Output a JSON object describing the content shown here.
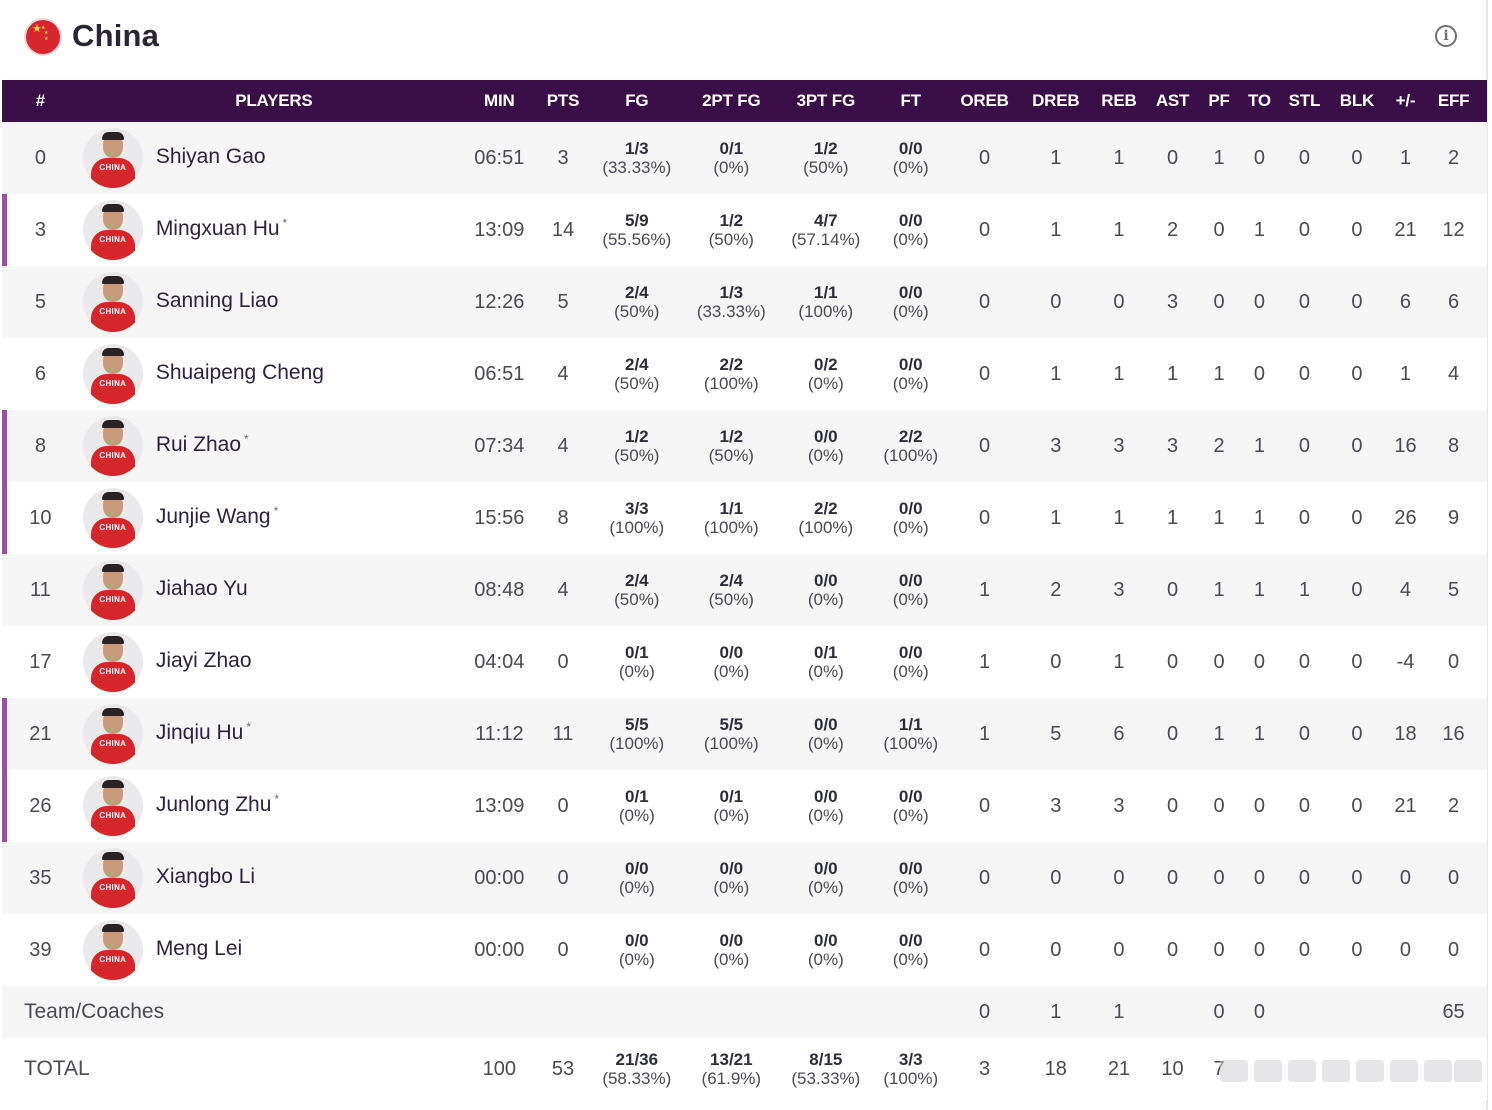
{
  "header": {
    "team_name": "China",
    "flag_icon": "china-flag-icon",
    "info_icon": "info-circle-icon"
  },
  "columns": [
    "#",
    "PLAYERS",
    "MIN",
    "PTS",
    "FG",
    "2PT FG",
    "3PT FG",
    "FT",
    "OREB",
    "DREB",
    "REB",
    "AST",
    "PF",
    "TO",
    "STL",
    "BLK",
    "+/-",
    "EFF"
  ],
  "players": [
    {
      "num": "0",
      "name": "Shiyan Gao",
      "star": "",
      "min": "06:51",
      "pts": "3",
      "fg": "1/3",
      "fg_pct": "(33.33%)",
      "fg2": "0/1",
      "fg2_pct": "(0%)",
      "fg3": "1/2",
      "fg3_pct": "(50%)",
      "ft": "0/0",
      "ft_pct": "(0%)",
      "oreb": "0",
      "dreb": "1",
      "reb": "1",
      "ast": "0",
      "pf": "1",
      "to": "0",
      "stl": "0",
      "blk": "0",
      "pm": "1",
      "eff": "2"
    },
    {
      "num": "3",
      "name": "Mingxuan Hu",
      "star": "*",
      "min": "13:09",
      "pts": "14",
      "fg": "5/9",
      "fg_pct": "(55.56%)",
      "fg2": "1/2",
      "fg2_pct": "(50%)",
      "fg3": "4/7",
      "fg3_pct": "(57.14%)",
      "ft": "0/0",
      "ft_pct": "(0%)",
      "oreb": "0",
      "dreb": "1",
      "reb": "1",
      "ast": "2",
      "pf": "0",
      "to": "1",
      "stl": "0",
      "blk": "0",
      "pm": "21",
      "eff": "12"
    },
    {
      "num": "5",
      "name": "Sanning Liao",
      "star": "",
      "min": "12:26",
      "pts": "5",
      "fg": "2/4",
      "fg_pct": "(50%)",
      "fg2": "1/3",
      "fg2_pct": "(33.33%)",
      "fg3": "1/1",
      "fg3_pct": "(100%)",
      "ft": "0/0",
      "ft_pct": "(0%)",
      "oreb": "0",
      "dreb": "0",
      "reb": "0",
      "ast": "3",
      "pf": "0",
      "to": "0",
      "stl": "0",
      "blk": "0",
      "pm": "6",
      "eff": "6"
    },
    {
      "num": "6",
      "name": "Shuaipeng Cheng",
      "star": "",
      "min": "06:51",
      "pts": "4",
      "fg": "2/4",
      "fg_pct": "(50%)",
      "fg2": "2/2",
      "fg2_pct": "(100%)",
      "fg3": "0/2",
      "fg3_pct": "(0%)",
      "ft": "0/0",
      "ft_pct": "(0%)",
      "oreb": "0",
      "dreb": "1",
      "reb": "1",
      "ast": "1",
      "pf": "1",
      "to": "0",
      "stl": "0",
      "blk": "0",
      "pm": "1",
      "eff": "4"
    },
    {
      "num": "8",
      "name": "Rui Zhao",
      "star": "*",
      "min": "07:34",
      "pts": "4",
      "fg": "1/2",
      "fg_pct": "(50%)",
      "fg2": "1/2",
      "fg2_pct": "(50%)",
      "fg3": "0/0",
      "fg3_pct": "(0%)",
      "ft": "2/2",
      "ft_pct": "(100%)",
      "oreb": "0",
      "dreb": "3",
      "reb": "3",
      "ast": "3",
      "pf": "2",
      "to": "1",
      "stl": "0",
      "blk": "0",
      "pm": "16",
      "eff": "8"
    },
    {
      "num": "10",
      "name": "Junjie Wang",
      "star": "*",
      "min": "15:56",
      "pts": "8",
      "fg": "3/3",
      "fg_pct": "(100%)",
      "fg2": "1/1",
      "fg2_pct": "(100%)",
      "fg3": "2/2",
      "fg3_pct": "(100%)",
      "ft": "0/0",
      "ft_pct": "(0%)",
      "oreb": "0",
      "dreb": "1",
      "reb": "1",
      "ast": "1",
      "pf": "1",
      "to": "1",
      "stl": "0",
      "blk": "0",
      "pm": "26",
      "eff": "9"
    },
    {
      "num": "11",
      "name": "Jiahao Yu",
      "star": "",
      "min": "08:48",
      "pts": "4",
      "fg": "2/4",
      "fg_pct": "(50%)",
      "fg2": "2/4",
      "fg2_pct": "(50%)",
      "fg3": "0/0",
      "fg3_pct": "(0%)",
      "ft": "0/0",
      "ft_pct": "(0%)",
      "oreb": "1",
      "dreb": "2",
      "reb": "3",
      "ast": "0",
      "pf": "1",
      "to": "1",
      "stl": "1",
      "blk": "0",
      "pm": "4",
      "eff": "5"
    },
    {
      "num": "17",
      "name": "Jiayi Zhao",
      "star": "",
      "min": "04:04",
      "pts": "0",
      "fg": "0/1",
      "fg_pct": "(0%)",
      "fg2": "0/0",
      "fg2_pct": "(0%)",
      "fg3": "0/1",
      "fg3_pct": "(0%)",
      "ft": "0/0",
      "ft_pct": "(0%)",
      "oreb": "1",
      "dreb": "0",
      "reb": "1",
      "ast": "0",
      "pf": "0",
      "to": "0",
      "stl": "0",
      "blk": "0",
      "pm": "-4",
      "eff": "0"
    },
    {
      "num": "21",
      "name": "Jinqiu Hu",
      "star": "*",
      "min": "11:12",
      "pts": "11",
      "fg": "5/5",
      "fg_pct": "(100%)",
      "fg2": "5/5",
      "fg2_pct": "(100%)",
      "fg3": "0/0",
      "fg3_pct": "(0%)",
      "ft": "1/1",
      "ft_pct": "(100%)",
      "oreb": "1",
      "dreb": "5",
      "reb": "6",
      "ast": "0",
      "pf": "1",
      "to": "1",
      "stl": "0",
      "blk": "0",
      "pm": "18",
      "eff": "16"
    },
    {
      "num": "26",
      "name": "Junlong Zhu",
      "star": "*",
      "min": "13:09",
      "pts": "0",
      "fg": "0/1",
      "fg_pct": "(0%)",
      "fg2": "0/1",
      "fg2_pct": "(0%)",
      "fg3": "0/0",
      "fg3_pct": "(0%)",
      "ft": "0/0",
      "ft_pct": "(0%)",
      "oreb": "0",
      "dreb": "3",
      "reb": "3",
      "ast": "0",
      "pf": "0",
      "to": "0",
      "stl": "0",
      "blk": "0",
      "pm": "21",
      "eff": "2"
    },
    {
      "num": "35",
      "name": "Xiangbo Li",
      "star": "",
      "min": "00:00",
      "pts": "0",
      "fg": "0/0",
      "fg_pct": "(0%)",
      "fg2": "0/0",
      "fg2_pct": "(0%)",
      "fg3": "0/0",
      "fg3_pct": "(0%)",
      "ft": "0/0",
      "ft_pct": "(0%)",
      "oreb": "0",
      "dreb": "0",
      "reb": "0",
      "ast": "0",
      "pf": "0",
      "to": "0",
      "stl": "0",
      "blk": "0",
      "pm": "0",
      "eff": "0"
    },
    {
      "num": "39",
      "name": "Meng Lei",
      "star": "",
      "min": "00:00",
      "pts": "0",
      "fg": "0/0",
      "fg_pct": "(0%)",
      "fg2": "0/0",
      "fg2_pct": "(0%)",
      "fg3": "0/0",
      "fg3_pct": "(0%)",
      "ft": "0/0",
      "ft_pct": "(0%)",
      "oreb": "0",
      "dreb": "0",
      "reb": "0",
      "ast": "0",
      "pf": "0",
      "to": "0",
      "stl": "0",
      "blk": "0",
      "pm": "0",
      "eff": "0"
    }
  ],
  "team_row": {
    "label": "Team/Coaches",
    "oreb": "0",
    "dreb": "1",
    "reb": "1",
    "pf": "0",
    "to": "0",
    "eff": "65"
  },
  "total_row": {
    "label": "TOTAL",
    "min": "100",
    "pts": "53",
    "fg": "21/36",
    "fg_pct": "(58.33%)",
    "fg2": "13/21",
    "fg2_pct": "(61.9%)",
    "fg3": "8/15",
    "fg3_pct": "(53.33%)",
    "ft": "3/3",
    "ft_pct": "(100%)",
    "oreb": "3",
    "dreb": "18",
    "reb": "21",
    "ast": "10",
    "pf": "7"
  },
  "starter_row_accent_color": "#9a4ea6",
  "header_bg_color": "#3a0f47"
}
